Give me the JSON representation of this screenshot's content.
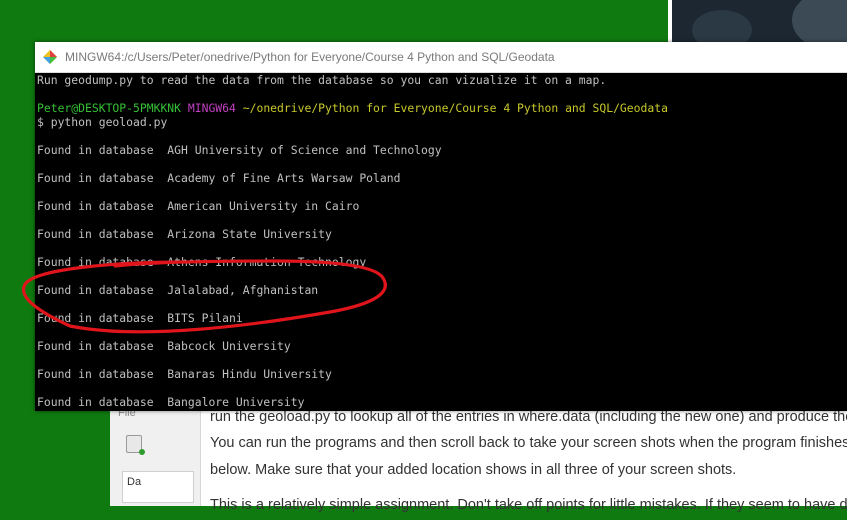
{
  "terminal": {
    "title": "MINGW64:/c/Users/Peter/onedrive/Python for Everyone/Course 4 Python and SQL/Geodata",
    "intro_line": "Run geodump.py to read the data from the database so you can vizualize it on a map.",
    "prompt": {
      "user_host": "Peter@DESKTOP-5PMKKNK",
      "shell": "MINGW64",
      "path": "~/onedrive/Python for Everyone/Course 4 Python and SQL/Geodata"
    },
    "command": "$ python geoload.py",
    "output_lines": [
      "Found in database  AGH University of Science and Technology",
      "Found in database  Academy of Fine Arts Warsaw Poland",
      "Found in database  American University in Cairo",
      "Found in database  Arizona State University",
      "Found in database  Athens Information Technology",
      "Found in database  Jalalabad, Afghanistan",
      "Found in database  BITS Pilani",
      "Found in database  Babcock University",
      "Found in database  Banaras Hindu University",
      "Found in database  Bangalore University"
    ],
    "colors": {
      "background": "#000000",
      "text": "#c0c0c0",
      "user_host": "#35c035",
      "shell": "#c040c0",
      "path": "#c8c82a",
      "annotation": "#e0141b"
    }
  },
  "background_window": {
    "menu_file": "File",
    "sidebar_label": "Da",
    "paragraphs": [
      "run the geoload.py to lookup all of the entries in where.data (including the new one) and produce the ge",
      "You can run the programs and then scroll back to take your screen shots when the program finishes. Th",
      "below. Make sure that your added location shows in all three of your screen shots.",
      "This is a relatively simple assignment. Don't take off points for little mistakes. If they seem to have done"
    ]
  },
  "icons": {
    "terminal_app": "mingw-diamond-icon",
    "toolbar": "add-file-icon"
  }
}
